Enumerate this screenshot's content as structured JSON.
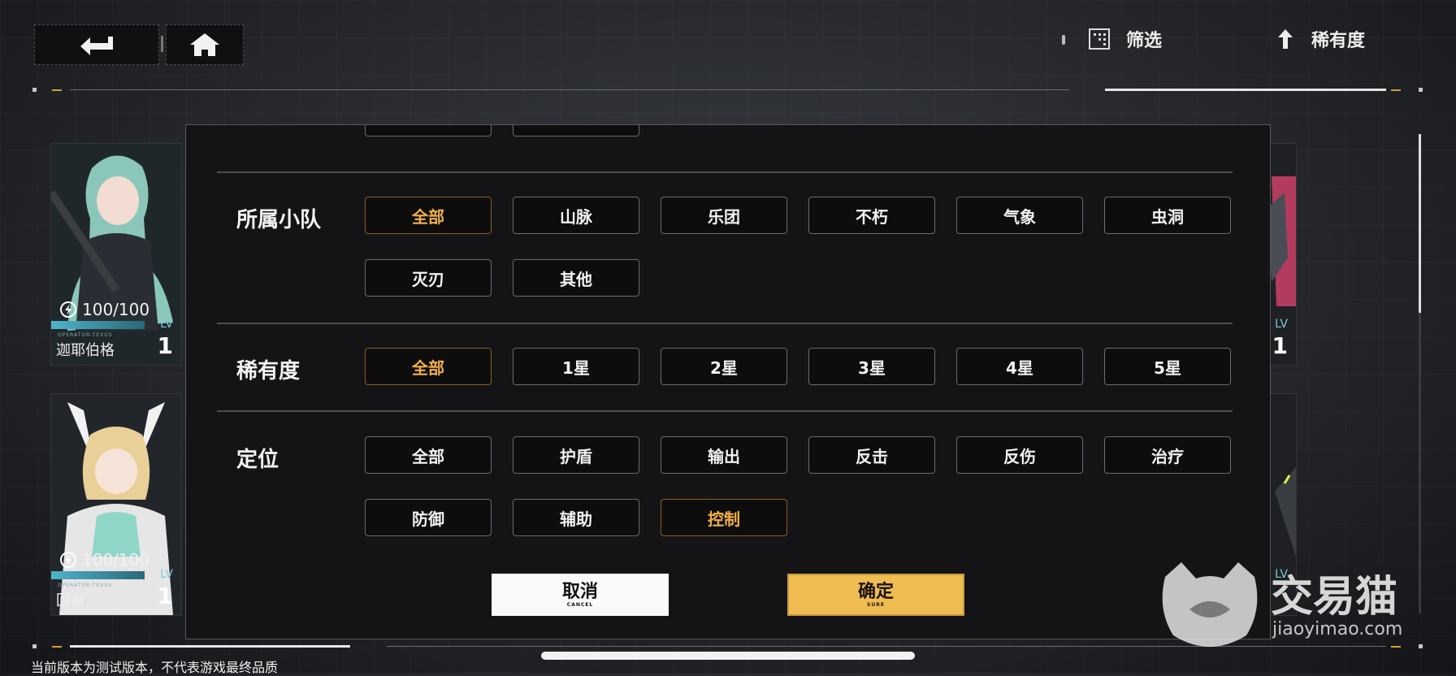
{
  "topbar": {
    "back_icon": "return-arrow-icon",
    "home_icon": "home-icon",
    "filter_label": "筛选",
    "sort_label": "稀有度",
    "sort_icon": "up-arrow-icon"
  },
  "left_cards": [
    {
      "energy": "100/100",
      "name": "迦耶伯格",
      "operator_tag": "OPERATOR-TEXUS",
      "lv_label": "LV",
      "level": "1"
    },
    {
      "energy": "100/100",
      "name": "回音",
      "operator_tag": "OPERATOR-TEXUS",
      "lv_label": "LV",
      "level": "1"
    }
  ],
  "right_cards": [
    {
      "lv_label": "LV",
      "level": "1"
    },
    {
      "lv_label": "LV"
    }
  ],
  "filter_modal": {
    "squad": {
      "title": "所属小队",
      "options": [
        "全部",
        "山脉",
        "乐团",
        "不朽",
        "气象",
        "虫洞",
        "灭刃",
        "其他"
      ],
      "selected": "全部"
    },
    "rarity": {
      "title": "稀有度",
      "options": [
        "全部",
        "1星",
        "2星",
        "3星",
        "4星",
        "5星"
      ],
      "selected": "全部"
    },
    "role": {
      "title": "定位",
      "options": [
        "全部",
        "护盾",
        "输出",
        "反击",
        "反伤",
        "治疗",
        "防御",
        "辅助",
        "控制"
      ],
      "selected": "控制"
    },
    "cancel_label": "取消",
    "cancel_sub": "CANCEL",
    "confirm_label": "确定",
    "confirm_sub": "SURE"
  },
  "footer": {
    "disclaimer": "当前版本为测试版本，不代表游戏最终品质"
  },
  "watermark": {
    "text": "交易猫",
    "url": "jiaoyimao.com"
  },
  "colors": {
    "accent_orange": "#f2b04a",
    "confirm_bg": "#f0bd52",
    "energy_bar": "#4fb4c8"
  }
}
